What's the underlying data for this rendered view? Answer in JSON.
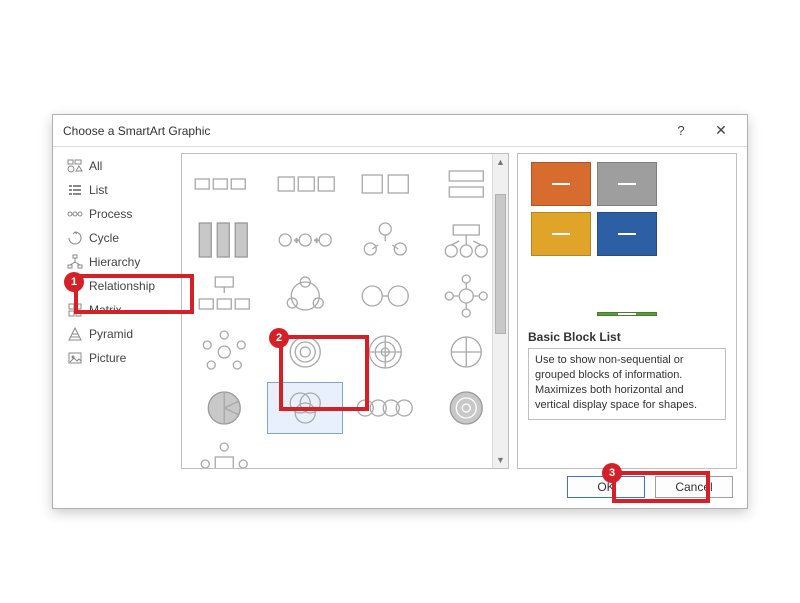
{
  "dialog": {
    "title": "Choose a SmartArt Graphic",
    "help_glyph": "?",
    "close_glyph": "✕"
  },
  "sidebar": {
    "items": [
      {
        "label": "All"
      },
      {
        "label": "List"
      },
      {
        "label": "Process"
      },
      {
        "label": "Cycle"
      },
      {
        "label": "Hierarchy"
      },
      {
        "label": "Relationship"
      },
      {
        "label": "Matrix"
      },
      {
        "label": "Pyramid"
      },
      {
        "label": "Picture"
      }
    ]
  },
  "preview": {
    "title": "Basic Block List",
    "desc": "Use to show non-sequential or grouped blocks of information. Maximizes both horizontal and vertical display space for shapes."
  },
  "buttons": {
    "ok": "OK",
    "cancel": "Cancel"
  },
  "callouts": {
    "one": "1",
    "two": "2",
    "three": "3"
  }
}
